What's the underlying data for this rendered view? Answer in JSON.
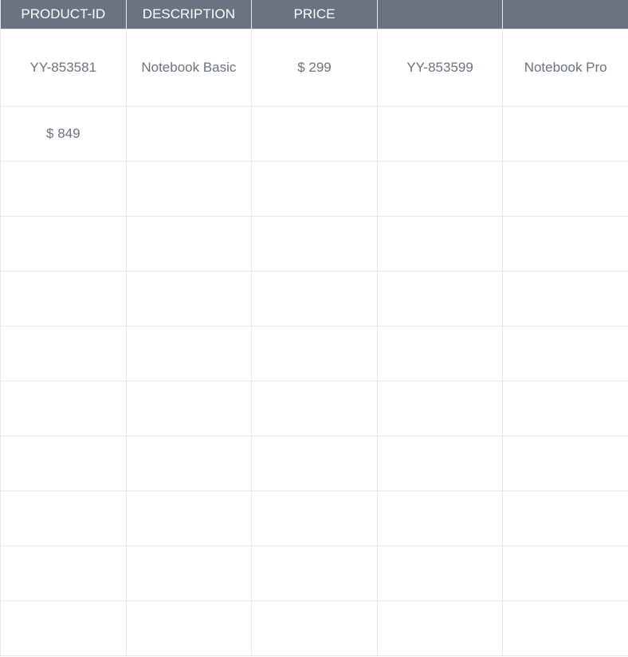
{
  "table": {
    "headers": [
      "PRODUCT-ID",
      "DESCRIPTION",
      "PRICE",
      "",
      ""
    ],
    "rows": [
      [
        "YY-853581",
        "Notebook Basic",
        "$ 299",
        "YY-853599",
        "Notebook Pro"
      ],
      [
        "$ 849",
        "",
        "",
        "",
        ""
      ],
      [
        "",
        "",
        "",
        "",
        ""
      ],
      [
        "",
        "",
        "",
        "",
        ""
      ],
      [
        "",
        "",
        "",
        "",
        ""
      ],
      [
        "",
        "",
        "",
        "",
        ""
      ],
      [
        "",
        "",
        "",
        "",
        ""
      ],
      [
        "",
        "",
        "",
        "",
        ""
      ],
      [
        "",
        "",
        "",
        "",
        ""
      ],
      [
        "",
        "",
        "",
        "",
        ""
      ],
      [
        "",
        "",
        "",
        "",
        ""
      ]
    ]
  },
  "colors": {
    "header_bg": "#6b7280",
    "header_text": "#ffffff",
    "cell_text": "#6b7280",
    "grid_line": "#e5e7eb"
  }
}
